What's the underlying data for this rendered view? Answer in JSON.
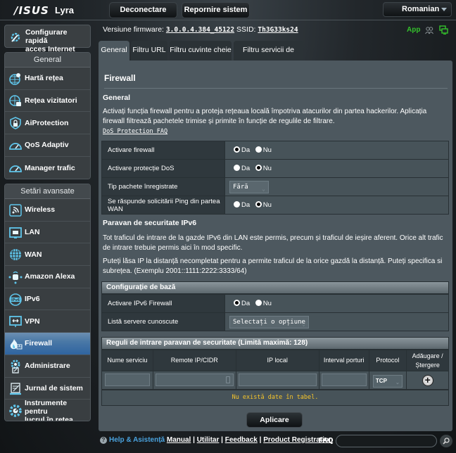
{
  "header": {
    "brand": "/ISUS",
    "model": "Lyra",
    "logout_label": "Deconectare",
    "reboot_label": "Repornire sistem",
    "language": "Romanian"
  },
  "info": {
    "firmware_label": "Versiune firmware:",
    "firmware_value": "3.0.0.4.384_45122",
    "ssid_label": "SSID:",
    "ssid_value": "Th3G33ks24",
    "app_label": "App",
    "accent_green": "#34c22c"
  },
  "quick_setup": {
    "label_line1": "Configurare rapidă",
    "label_line2": "acces Internet",
    "icon": "wizard-icon"
  },
  "sidebar": {
    "general_title": "General",
    "general_items": [
      {
        "label": "Hartă rețea",
        "icon": "network-map-icon"
      },
      {
        "label": "Rețea vizitatori",
        "icon": "guest-network-icon"
      },
      {
        "label": "AiProtection",
        "icon": "shield-lock-icon"
      },
      {
        "label": "QoS Adaptiv",
        "icon": "speedometer-icon"
      },
      {
        "label": "Manager trafic",
        "icon": "speedometer-icon"
      }
    ],
    "advanced_title": "Setări avansate",
    "advanced_items": [
      {
        "label": "Wireless",
        "icon": "wireless-icon"
      },
      {
        "label": "LAN",
        "icon": "lan-icon"
      },
      {
        "label": "WAN",
        "icon": "globe-icon"
      },
      {
        "label": "Amazon Alexa",
        "icon": "alexa-icon"
      },
      {
        "label": "IPv6",
        "icon": "ipv6-icon"
      },
      {
        "label": "VPN",
        "icon": "vpn-icon"
      },
      {
        "label": "Firewall",
        "icon": "firewall-icon",
        "active": true
      },
      {
        "label": "Administrare",
        "icon": "admin-gear-icon"
      },
      {
        "label": "Jurnal de sistem",
        "icon": "system-log-icon"
      },
      {
        "label_line1": "Instrumente pentru",
        "label_line2": "lucrul în rețea",
        "icon": "network-tools-icon"
      }
    ]
  },
  "tabs": [
    {
      "label": "General",
      "active": true
    },
    {
      "label": "Filtru URL"
    },
    {
      "label": "Filtru cuvinte cheie"
    },
    {
      "label": "Filtru servicii de rețea"
    }
  ],
  "page": {
    "title": "Firewall",
    "general": {
      "title": "General",
      "description": "Activați funcția firewall pentru a proteja rețeaua locală împotriva atacurilor din partea hackerilor. Aplicația firewall filtrează pachetele trimise și primite în funcție de regulile de filtrare.",
      "faq_link": "DoS Protection FAQ",
      "rows": [
        {
          "label": "Activare firewall",
          "type": "radio",
          "options": [
            "Da",
            "Nu"
          ],
          "selected": "Da"
        },
        {
          "label": "Activare protecție DoS",
          "type": "radio",
          "options": [
            "Da",
            "Nu"
          ],
          "selected": "Nu"
        },
        {
          "label": "Tip pachete înregistrate",
          "type": "select",
          "value": "Fără"
        },
        {
          "label": "Se răspunde solicitării Ping din partea WAN",
          "type": "radio",
          "options": [
            "Da",
            "Nu"
          ],
          "selected": "Nu"
        }
      ]
    },
    "ipv6": {
      "title": "Paravan de securitate IPv6",
      "para1": "Tot traficul de intrare de la gazde IPv6 din LAN este permis, precum și traficul de ieșire aferent. Orice alt trafic de intrare trebuie permis aici în mod specific.",
      "para2": "Puteți lăsa IP la distanță necompletat pentru a permite traficul de la orice gazdă la distanță. Puteți specifica si subrețea. (Exemplu 2001::1111:2222:3333/64)",
      "basic_config_title": "Configurație de bază",
      "rows": [
        {
          "label": "Activare IPv6 Firewall",
          "type": "radio",
          "options": [
            "Da",
            "Nu"
          ],
          "selected": "Da"
        },
        {
          "label": "Listă servere cunoscute",
          "type": "select",
          "value": "Selectați o opțiune"
        }
      ]
    },
    "rules": {
      "title": "Reguli de intrare paravan de securitate (Limită maximă: 128)",
      "columns": [
        "Nume serviciu",
        "Remote IP/CIDR",
        "IP local",
        "Interval porturi",
        "Protocol",
        "Adăugare / Ștergere"
      ],
      "new_row": {
        "service": "",
        "remote_ip": "",
        "local_ip": "",
        "port_range": "",
        "protocol": "TCP"
      },
      "empty_text": "Nu există date în tabel."
    },
    "apply_label": "Aplicare"
  },
  "footer": {
    "help_label": "Help & Asistență",
    "links": [
      "Manual",
      "Utilitar",
      "Feedback",
      "Product Registration"
    ],
    "faq_label": "FAQ",
    "faq_placeholder": ""
  }
}
